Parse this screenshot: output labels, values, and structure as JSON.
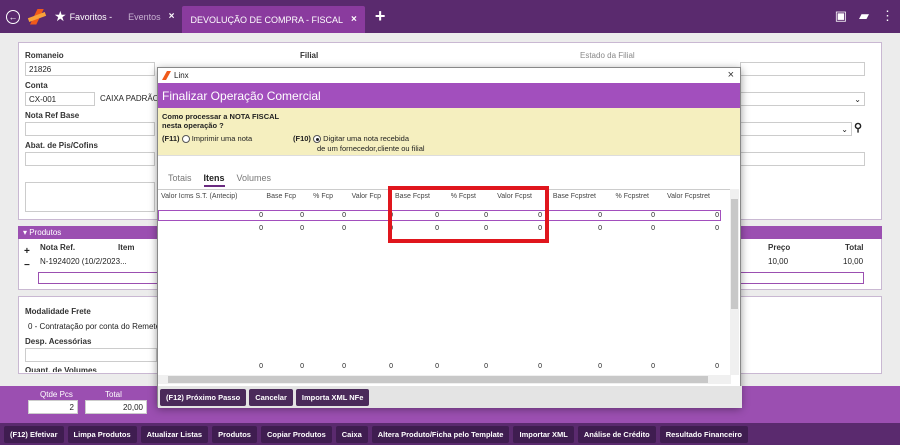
{
  "topbar": {
    "tabs": [
      {
        "label": "Favoritos",
        "suffix": "-"
      },
      {
        "label": "Eventos",
        "close": "×"
      },
      {
        "label": "DEVOLUÇÃO DE COMPRA - FISCAL",
        "close": "×"
      }
    ],
    "add": "+"
  },
  "form": {
    "romaneio_label": "Romaneio",
    "romaneio_value": "21826",
    "filial_label": "Filial",
    "estado_filial_label": "Estado da Filial",
    "conta_label": "Conta",
    "conta_code": "CX-001",
    "conta_name": "CAIXA PADRÃO C",
    "nota_ref_label": "Nota Ref Base",
    "abat_label": "Abat. de Pis/Cofins"
  },
  "produtos": {
    "title": "Produtos",
    "col_nota": "Nota Ref.",
    "col_item": "Item",
    "col_preco": "Preço",
    "col_total": "Total",
    "row_nota": "N-1924020 (10/2/2023...",
    "row_preco": "10,00",
    "row_total": "10,00"
  },
  "frete": {
    "modalidade_label": "Modalidade Frete",
    "modalidade_value": "0 - Contratação por conta do Remete",
    "desp_label": "Desp. Acessórias",
    "quant_label": "Quant. de Volumes"
  },
  "bottom": {
    "qtde_label": "Qtde Pcs",
    "qtde_value": "2",
    "total_label": "Total",
    "total_value": "20,00"
  },
  "buttons": [
    "(F12) Efetivar",
    "Limpa Produtos",
    "Atualizar Listas",
    "Produtos",
    "Copiar Produtos",
    "Caixa",
    "Altera Produto/Ficha pelo Template",
    "Importar XML",
    "Análise de Crédito",
    "Resultado Financeiro"
  ],
  "dialog": {
    "window_title": "Linx",
    "close": "×",
    "header": "Finalizar Operação Comercial",
    "question_line1": "Como processar a NOTA FISCAL",
    "question_line2": "nesta operação ?",
    "opt1_key": "(F11)",
    "opt1_label": "Imprimir uma nota",
    "opt2_key": "(F10)",
    "opt2_label1": "Digitar uma nota recebida",
    "opt2_label2": "de um fornecedor,cliente ou filial",
    "tabs": [
      "Totais",
      "Itens",
      "Volumes"
    ],
    "columns": [
      "Valor Icms S.T. (Antecip)",
      "Base Fcp",
      "% Fcp",
      "Valor Fcp",
      "Base Fcpst",
      "% Fcpst",
      "Valor Fcpst",
      "Base Fcpstret",
      "% Fcpstret",
      "Valor Fcpstret"
    ],
    "row1": [
      "0",
      "0",
      "0",
      "0",
      "0",
      "0",
      "0",
      "0",
      "0",
      "0"
    ],
    "row2": [
      "0",
      "0",
      "0",
      "0",
      "0",
      "0",
      "0",
      "0",
      "0",
      "0"
    ],
    "totals": [
      "0",
      "0",
      "0",
      "0",
      "0",
      "0",
      "0",
      "0",
      "0",
      "0"
    ],
    "footer": [
      "(F12) Próximo Passo",
      "Cancelar",
      "Importa XML NFe"
    ]
  },
  "colors": {
    "accent": "#a24fbd",
    "topbar": "#5a2a6e",
    "highlight": "#e0161d"
  }
}
